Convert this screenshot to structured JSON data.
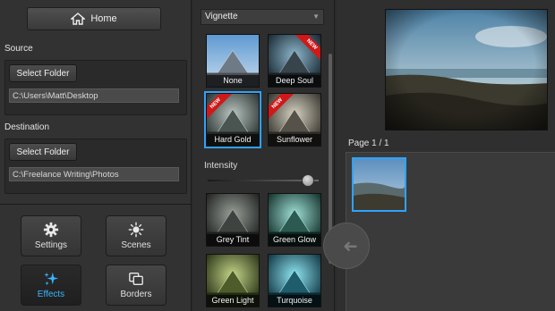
{
  "home": {
    "label": "Home",
    "icon": "home-icon"
  },
  "source": {
    "title": "Source",
    "button": "Select Folder",
    "path": "C:\\Users\\Matt\\Desktop"
  },
  "destination": {
    "title": "Destination",
    "button": "Select Folder",
    "path": "C:\\Freelance Writing\\Photos"
  },
  "tools": [
    {
      "label": "Settings",
      "icon": "gear-icon",
      "active": false
    },
    {
      "label": "Scenes",
      "icon": "sun-icon",
      "active": false
    },
    {
      "label": "Effects",
      "icon": "sparkle-icon",
      "active": true
    },
    {
      "label": "Borders",
      "icon": "borders-icon",
      "active": false
    }
  ],
  "effects": {
    "category": "Vignette",
    "row1": [
      {
        "label": "None",
        "badge": ""
      },
      {
        "label": "Deep Soul",
        "badge": "NEW"
      },
      {
        "label": "Hard Gold",
        "badge": "NEW"
      },
      {
        "label": "Sunflower",
        "badge": "NEW"
      }
    ],
    "intensity_label": "Intensity",
    "intensity": 0.95,
    "row2": [
      {
        "label": "Grey Tint",
        "badge": ""
      },
      {
        "label": "Green Glow",
        "badge": ""
      },
      {
        "label": "Green Light",
        "badge": ""
      },
      {
        "label": "Turquoise",
        "badge": ""
      }
    ],
    "selected": "Hard Gold"
  },
  "pages": {
    "label": "Page 1 / 1"
  },
  "colors": {
    "accent": "#2ea3ff",
    "ribbon": "#d01818"
  }
}
